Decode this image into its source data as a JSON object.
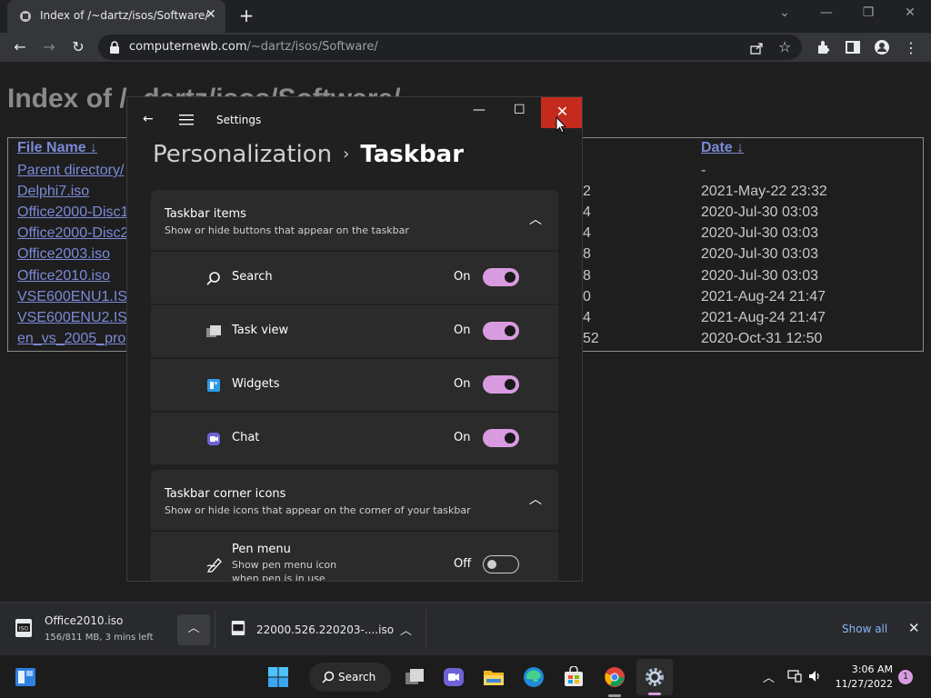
{
  "browser": {
    "tab_title": "Index of /~dartz/isos/Software/",
    "url_host": "computernewb.com",
    "url_path": "/~dartz/isos/Software/"
  },
  "page": {
    "heading": "Index of /~dartz/isos/Software/",
    "columns": {
      "file_name": "File Name",
      "sort_indicator": "↓",
      "date": "Date"
    },
    "rows": [
      {
        "name": "Parent directory/",
        "size": "",
        "date": "-"
      },
      {
        "name": "Delphi7.iso",
        "size": "2",
        "date": "2021-May-22 23:32"
      },
      {
        "name": "Office2000-Disc1",
        "size": "4",
        "date": "2020-Jul-30 03:03"
      },
      {
        "name": "Office2000-Disc2",
        "size": "4",
        "date": "2020-Jul-30 03:03"
      },
      {
        "name": "Office2003.iso",
        "size": "8",
        "date": "2020-Jul-30 03:03"
      },
      {
        "name": "Office2010.iso",
        "size": "8",
        "date": "2020-Jul-30 03:03"
      },
      {
        "name": "VSE600ENU1.IS",
        "size": "0",
        "date": "2021-Aug-24 21:47"
      },
      {
        "name": "VSE600ENU2.IS",
        "size": "4",
        "date": "2021-Aug-24 21:47"
      },
      {
        "name": "en_vs_2005_pro",
        "size": "52",
        "date": "2020-Oct-31 12:50"
      }
    ]
  },
  "settings": {
    "app_title": "Settings",
    "breadcrumb_parent": "Personalization",
    "breadcrumb_current": "Taskbar",
    "group1": {
      "title": "Taskbar items",
      "subtitle": "Show or hide buttons that appear on the taskbar",
      "items": [
        {
          "label": "Search",
          "state": "On",
          "icon": "search-icon"
        },
        {
          "label": "Task view",
          "state": "On",
          "icon": "task-view-icon"
        },
        {
          "label": "Widgets",
          "state": "On",
          "icon": "widgets-icon"
        },
        {
          "label": "Chat",
          "state": "On",
          "icon": "chat-icon"
        }
      ]
    },
    "group2": {
      "title": "Taskbar corner icons",
      "subtitle": "Show or hide icons that appear on the corner of your taskbar",
      "pen_menu": {
        "label": "Pen menu",
        "desc_line1": "Show pen menu icon",
        "desc_line2": "when pen is in use",
        "state": "Off"
      }
    },
    "accent_color": "#d99be0",
    "close_color": "#c42b1c"
  },
  "downloads": {
    "item1_name": "Office2010.iso",
    "item1_progress": "156/811 MB, 3 mins left",
    "item2_name": "22000.526.220203-....iso",
    "show_all": "Show all"
  },
  "taskbar": {
    "search_label": "Search",
    "time": "3:06 AM",
    "date": "11/27/2022",
    "notification_count": "1"
  }
}
